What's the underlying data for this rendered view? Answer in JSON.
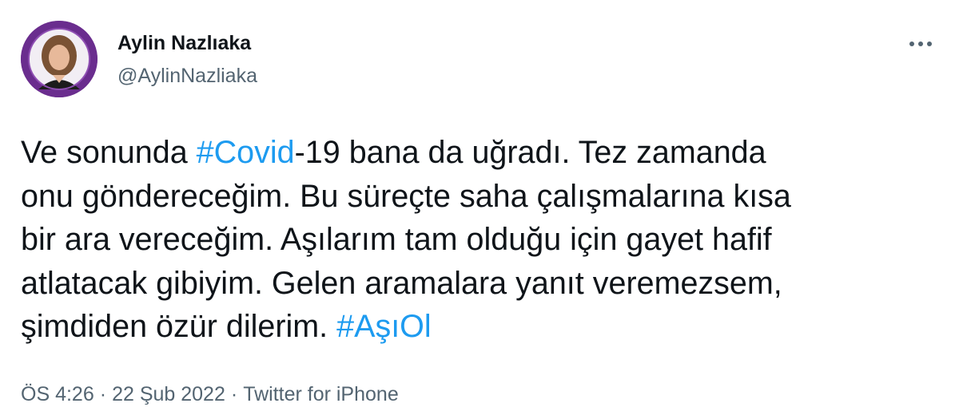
{
  "author": {
    "display_name": "Aylin Nazlıaka",
    "handle": "@AylinNazliaka",
    "avatar_ring_color": "#6a2d8e"
  },
  "more_icon": "more-horizontal-icon",
  "tweet": {
    "line1": {
      "before": "Ve sonunda ",
      "hashtag": "#Covid",
      "after": "-19 bana da uğradı. Tez zamanda"
    },
    "line2": "onu göndereceğim. Bu süreçte saha çalışmalarına kısa",
    "line3": "bir ara vereceğim. Aşılarım tam olduğu için gayet hafif",
    "line4": "atlatacak gibiyim. Gelen aramalara yanıt veremezsem,",
    "line5": {
      "before": "şimdiden özür dilerim. ",
      "hashtag": "#AşıOl"
    }
  },
  "meta": {
    "time": "ÖS 4:26",
    "separator": "·",
    "date": "22 Şub 2022",
    "source": "Twitter for iPhone"
  },
  "colors": {
    "link": "#1d9bf0",
    "text": "#0f1419",
    "secondary": "#536471"
  }
}
